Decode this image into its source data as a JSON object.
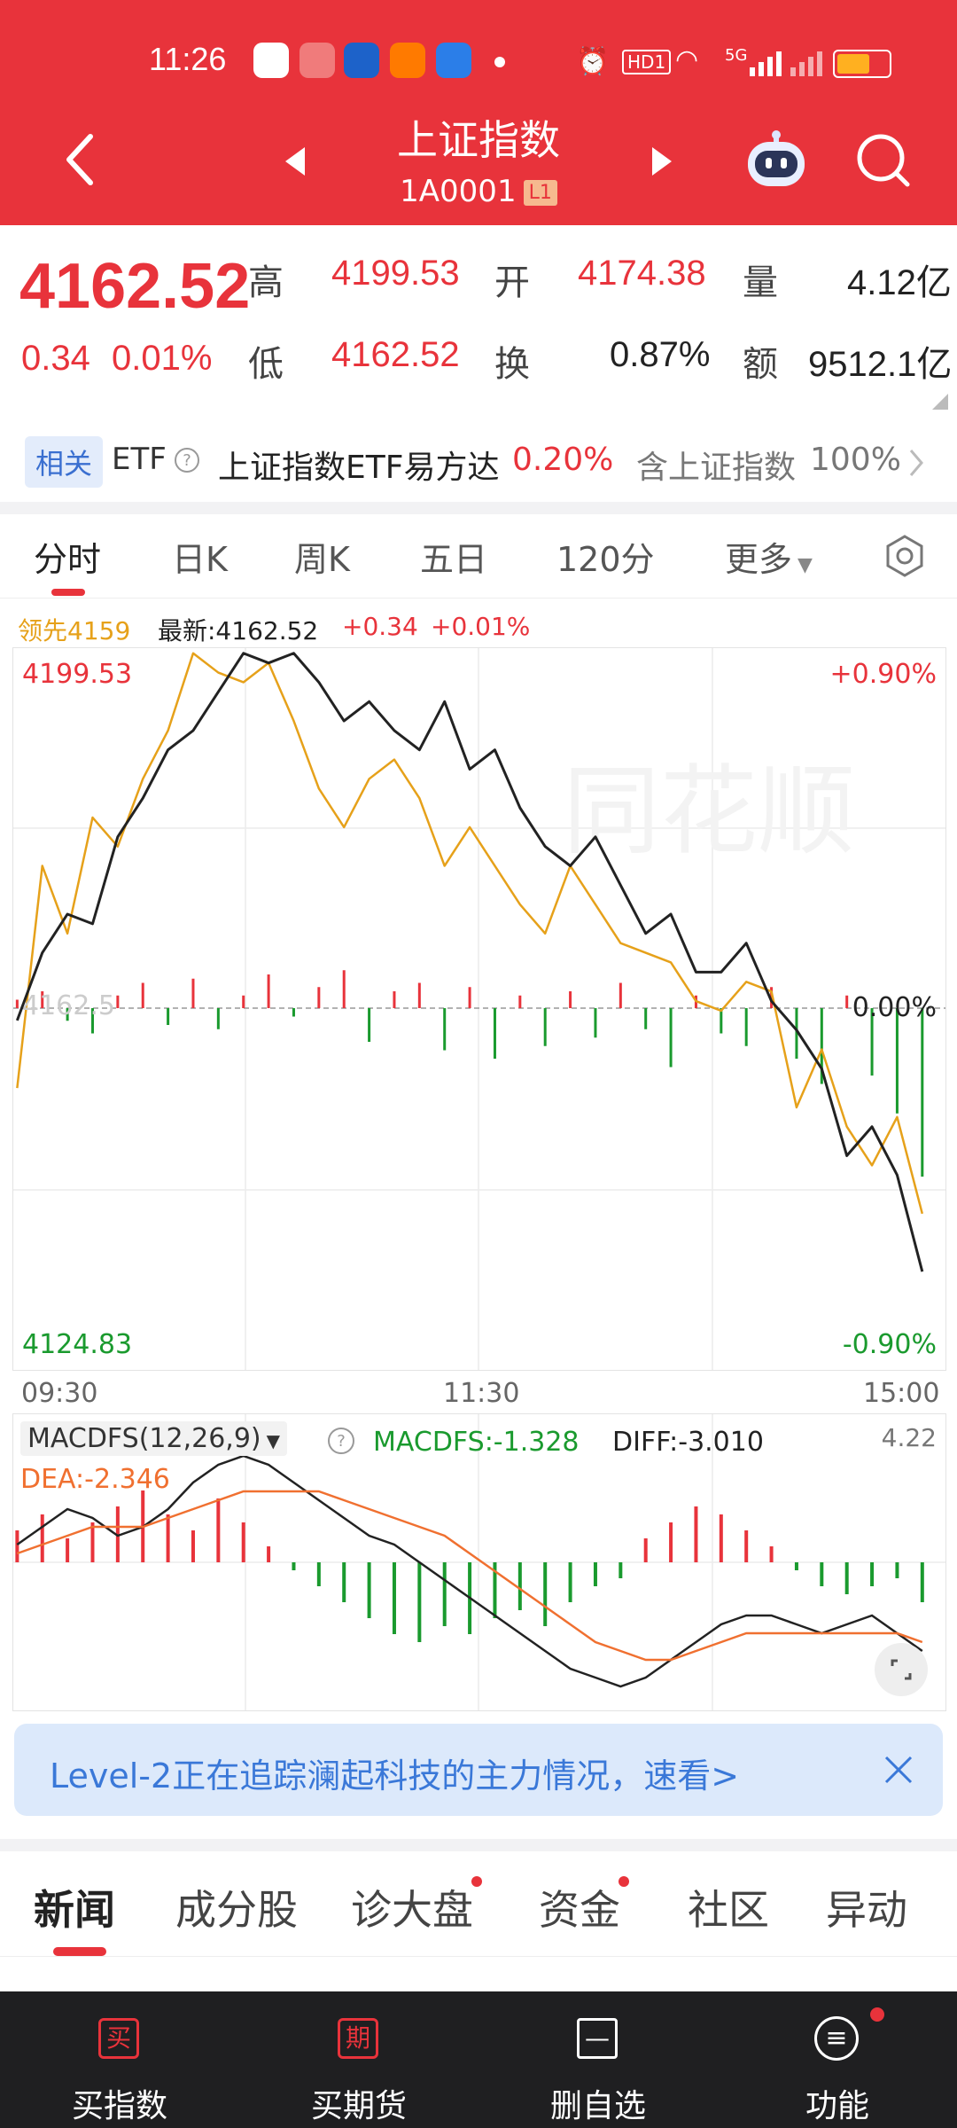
{
  "status": {
    "time": "11:26",
    "hd": "HD1",
    "net": "5G"
  },
  "header": {
    "title": "上证指数",
    "code": "1A0001",
    "badge": "L1"
  },
  "quote": {
    "price": "4162.52",
    "change": "0.34",
    "change_pct": "0.01%",
    "high_label": "高",
    "high": "4199.53",
    "low_label": "低",
    "low": "4162.52",
    "open_label": "开",
    "open": "4174.38",
    "turnover_label": "换",
    "turnover": "0.87%",
    "volume_label": "量",
    "volume": "4.12亿",
    "amount_label": "额",
    "amount": "9512.1亿"
  },
  "etf": {
    "tag": "相关",
    "label": "ETF",
    "name": "上证指数ETF易方达",
    "pct": "0.20%",
    "contains": "含上证指数",
    "weight": "100%"
  },
  "tabs": [
    "分时",
    "日K",
    "周K",
    "五日",
    "120分",
    "更多"
  ],
  "chart_info": {
    "leader": "领先4159",
    "latest": "最新:4162.52",
    "chg": "+0.34",
    "chg_pct": "+0.01%"
  },
  "chart_data": {
    "type": "line",
    "y_top": "4199.53",
    "y_bottom": "4124.83",
    "y_mid": "4162.5",
    "pct_top": "+0.90%",
    "pct_mid": "0.00%",
    "pct_bottom": "-0.90%",
    "x_labels": [
      "09:30",
      "11:30",
      "15:00"
    ],
    "price": [
      4161,
      4168,
      4172,
      4171,
      4180,
      4184,
      4189,
      4191,
      4195,
      4199,
      4198,
      4199,
      4196,
      4192,
      4194,
      4191,
      4189,
      4194,
      4187,
      4189,
      4183,
      4179,
      4177,
      4180,
      4175,
      4170,
      4172,
      4166,
      4166,
      4169,
      4163,
      4160,
      4156,
      4147,
      4150,
      4145,
      4135
    ],
    "leader": [
      4154,
      4177,
      4170,
      4182,
      4179,
      4186,
      4191,
      4199,
      4197,
      4196,
      4198,
      4192,
      4185,
      4181,
      4186,
      4188,
      4184,
      4177,
      4181,
      4177,
      4173,
      4170,
      4177,
      4173,
      4169,
      4168,
      4167,
      4163,
      4162,
      4165,
      4164,
      4152,
      4158,
      4150,
      4146,
      4151,
      4141
    ],
    "volume": [
      2,
      4,
      -3,
      -6,
      3,
      6,
      -4,
      7,
      -5,
      3,
      8,
      -2,
      5,
      9,
      -8,
      4,
      6,
      -10,
      5,
      -12,
      3,
      -9,
      4,
      -7,
      6,
      -5,
      -14,
      3,
      -6,
      -9,
      5,
      -12,
      -18,
      3,
      -16,
      -25,
      -40
    ],
    "macd_label": "MACDFS(12,26,9)",
    "macd": "MACDFS:-1.328",
    "diff": "DIFF:-3.010",
    "dea": "DEA:-2.346",
    "macd_max": "4.22",
    "macd_hist": [
      4,
      6,
      3,
      5,
      7,
      9,
      6,
      4,
      8,
      5,
      2,
      -1,
      -3,
      -5,
      -7,
      -9,
      -10,
      -8,
      -9,
      -7,
      -6,
      -8,
      -5,
      -3,
      -2,
      3,
      5,
      7,
      6,
      4,
      2,
      -1,
      -3,
      -4,
      -3,
      -2,
      -5
    ],
    "diff_line": [
      2,
      4,
      6,
      5,
      3,
      4,
      6,
      9,
      11,
      12,
      11,
      9,
      7,
      5,
      3,
      2,
      0,
      -2,
      -4,
      -6,
      -8,
      -10,
      -12,
      -13,
      -14,
      -13,
      -11,
      -9,
      -7,
      -6,
      -6,
      -7,
      -8,
      -7,
      -6,
      -8,
      -10
    ],
    "dea_line": [
      1,
      2,
      3,
      4,
      4,
      4,
      5,
      6,
      7,
      8,
      8,
      8,
      8,
      7,
      6,
      5,
      4,
      3,
      1,
      -1,
      -3,
      -5,
      -7,
      -9,
      -10,
      -11,
      -11,
      -10,
      -9,
      -8,
      -8,
      -8,
      -8,
      -8,
      -8,
      -8,
      -9
    ]
  },
  "banner": {
    "text": "Level-2正在追踪澜起科技的主力情况，速看>"
  },
  "news_tabs": [
    "新闻",
    "成分股",
    "诊大盘",
    "资金",
    "社区",
    "异动"
  ],
  "bottom_nav": [
    {
      "icon": "买",
      "label": "买指数"
    },
    {
      "icon": "期",
      "label": "买期货"
    },
    {
      "icon": "—",
      "label": "删自选"
    },
    {
      "icon": "≡",
      "label": "功能"
    }
  ],
  "colors": {
    "brand": "#e8333b",
    "up": "#e8333b",
    "down": "#1a9a2e",
    "leader": "#e6a11a"
  }
}
